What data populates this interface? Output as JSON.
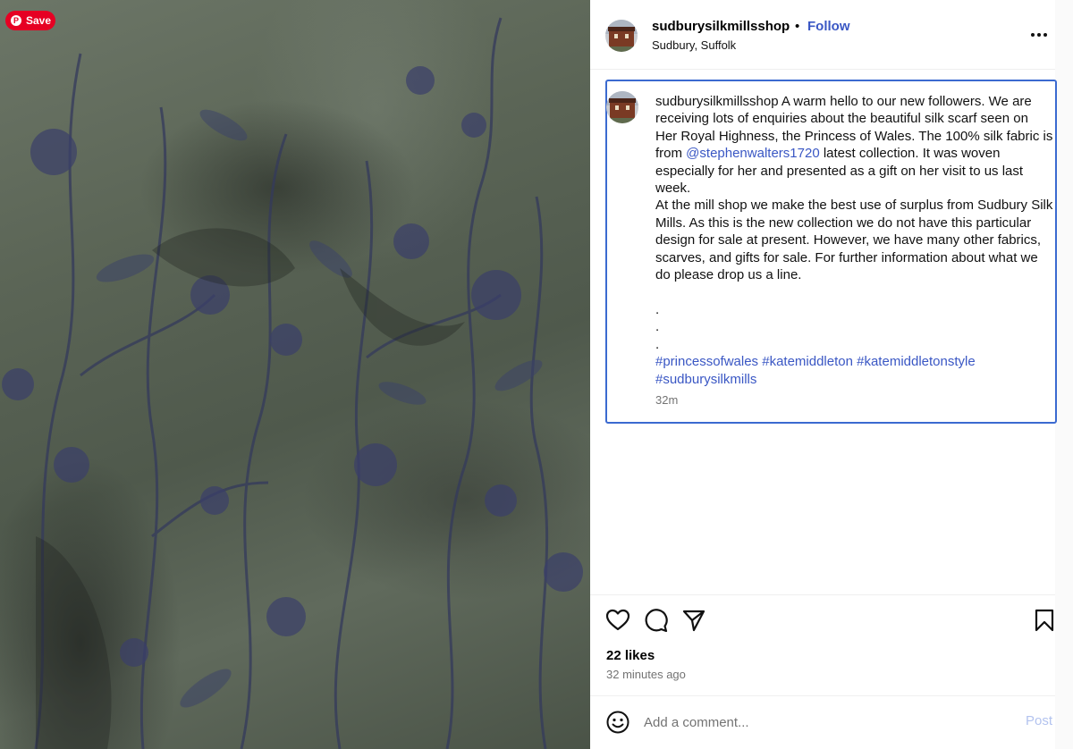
{
  "save_button": {
    "label": "Save",
    "icon": "pinterest-icon"
  },
  "post": {
    "username": "sudburysilkmillsshop",
    "follow_label": "Follow",
    "separator": "•",
    "location": "Sudbury, Suffolk",
    "caption": {
      "username": "sudburysilkmillsshop",
      "text_1": " A warm hello to our new followers. We are receiving lots of enquiries about the beautiful silk scarf seen on Her Royal Highness, the Princess of Wales. The 100% silk fabric is from ",
      "mention": "@stephenwalters1720",
      "text_2": " latest collection. It was woven especially for her and presented as a gift on her visit to us last week.\nAt the mill shop we make the best use of surplus from Sudbury Silk Mills. As this is the new collection we do not have this particular design for sale at present. However, we have many other fabrics, scarves, and gifts for sale. For further information about what we do please drop us a line.\n\n.\n.\n.\n",
      "hashtags": "#princessofwales #katemiddleton #katemiddletonstyle #sudburysilkmills",
      "time": "32m"
    },
    "likes": "22 likes",
    "time_ago": "32 minutes ago",
    "comment": {
      "placeholder": "Add a comment...",
      "post_label": "Post"
    },
    "colors": {
      "link": "#3a57c4",
      "highlight_border": "#3b6ad0",
      "save_red": "#e60023"
    }
  }
}
